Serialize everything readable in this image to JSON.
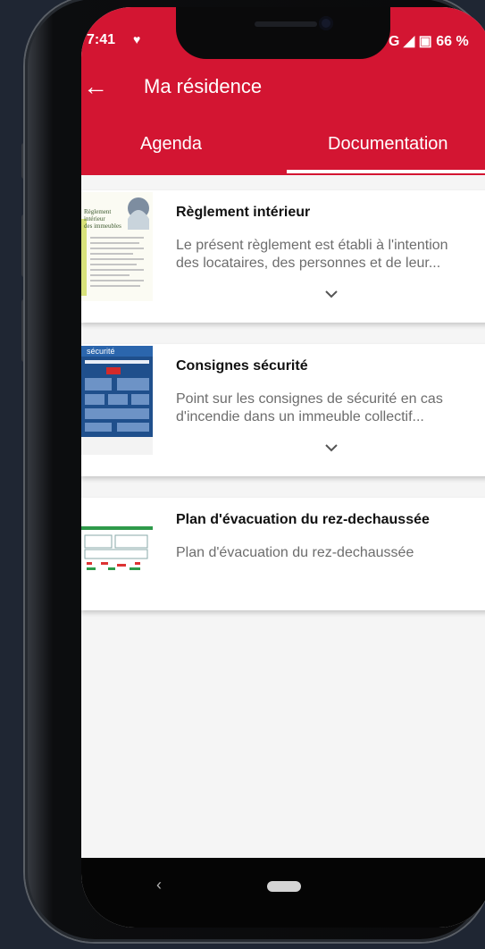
{
  "status_bar": {
    "time": "7:41",
    "right": "G ◢ ▣ 66 %"
  },
  "header": {
    "title": "Ma résidence"
  },
  "tabs": [
    {
      "label": "Agenda",
      "selected": false
    },
    {
      "label": "Documentation",
      "selected": true
    }
  ],
  "documents": [
    {
      "title": "Règlement intérieur",
      "desc_line1": "Le présent règlement est établi à l'intention",
      "desc_line2": "des locataires, des personnes et de leur...",
      "thumb_text": "Règlement intérieur des immeubles",
      "expandable": true
    },
    {
      "title": "Consignes sécurité",
      "desc_line1": "Point sur les consignes de sécurité en cas",
      "desc_line2": "d'incendie dans un immeuble collectif...",
      "thumb_text": "sécurité",
      "expandable": true
    },
    {
      "title": "Plan d'évacuation du rez-dechaussée",
      "desc_line1": "Plan d'évacuation du rez-dechaussée",
      "expandable": false
    }
  ],
  "colors": {
    "brand": "#d31532",
    "background": "#f5f5f5"
  },
  "icons": {
    "back": "arrow-left-icon",
    "expand": "chevron-down-icon",
    "nav_back": "nav-back-icon",
    "nav_home": "nav-home-pill"
  }
}
